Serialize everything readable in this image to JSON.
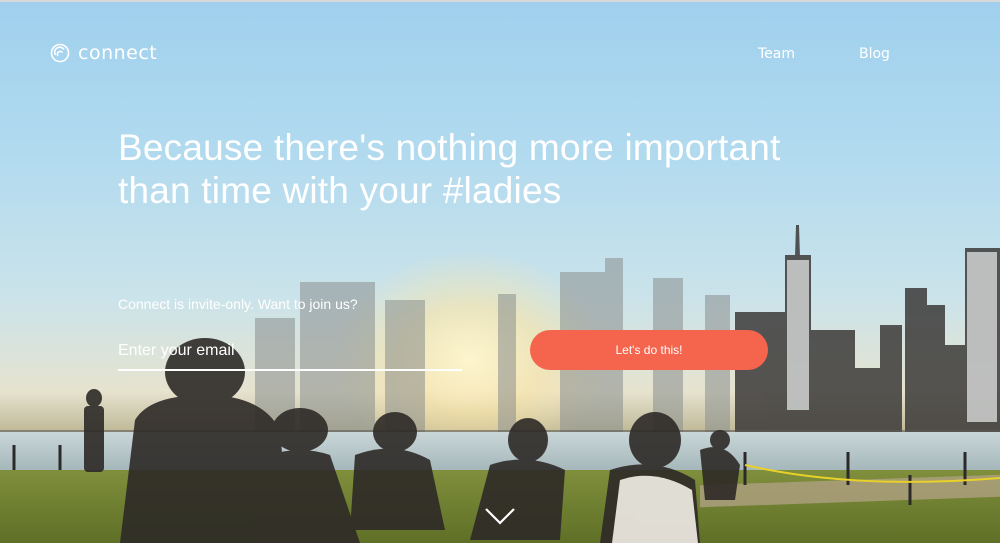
{
  "brand": {
    "name": "connect",
    "accent": "#f5654d"
  },
  "nav": {
    "items": [
      {
        "label": "Team"
      },
      {
        "label": "Blog"
      }
    ]
  },
  "hero": {
    "headline_line1": "Because there's nothing more important",
    "headline_line2": "than time with your #ladies",
    "invite_text": "Connect is invite-only. Want to join us?",
    "email_placeholder": "Enter your email",
    "cta_label": "Let's do this!"
  },
  "icons": {
    "logo": "connect-logo-icon",
    "scroll": "chevron-down-icon"
  }
}
